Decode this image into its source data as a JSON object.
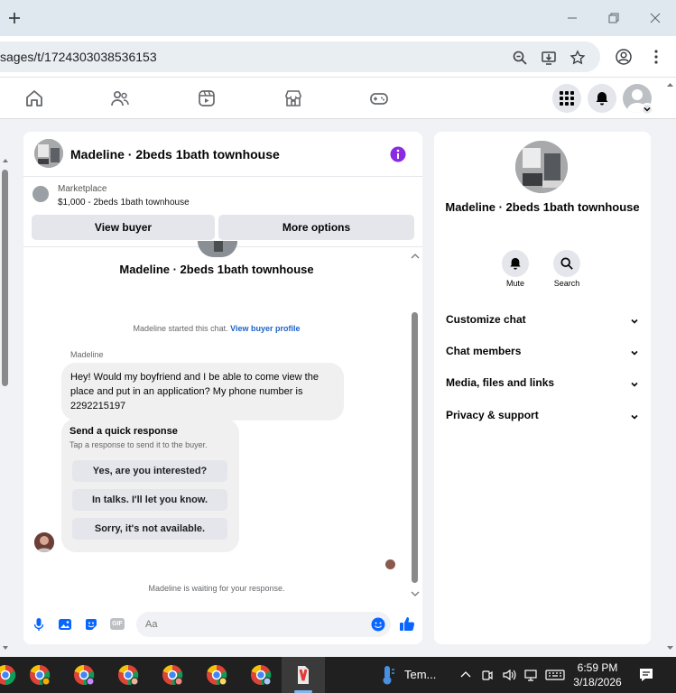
{
  "browser": {
    "url": "sages/t/1724303038536153"
  },
  "chat": {
    "title": "Madeline · 2beds 1bath townhouse",
    "marketplace_label": "Marketplace",
    "marketplace_price": "$1,000 - 2beds 1bath townhouse",
    "view_buyer_label": "View buyer",
    "more_options_label": "More options",
    "listing_title": "Madeline · 2beds 1bath townhouse",
    "started_text": "Madeline started this chat.",
    "view_buyer_profile_label": "View buyer profile",
    "sender_name": "Madeline",
    "message": "Hey! Would my boyfriend and I be able to come view the place and put in an application? My phone number is 2292215197",
    "quick_title": "Send a quick response",
    "quick_sub": "Tap a response to send it to the buyer.",
    "quick_responses": [
      "Yes, are you interested?",
      "In talks. I'll let you know.",
      "Sorry, it's not available."
    ],
    "waiting_text": "Madeline is waiting for your response.",
    "input_placeholder": "Aa",
    "gif_label": "GIF"
  },
  "details": {
    "title": "Madeline · 2beds 1bath townhouse",
    "mute_label": "Mute",
    "search_label": "Search",
    "rows": [
      "Customize chat",
      "Chat members",
      "Media, files and links",
      "Privacy & support"
    ]
  },
  "taskbar": {
    "weather_label": "Tem...",
    "time": "6:59 PM",
    "date": "3/18/2026"
  },
  "colors": {
    "accent": "#0866ff",
    "info": "#8a2be2",
    "like": "#0866ff"
  }
}
